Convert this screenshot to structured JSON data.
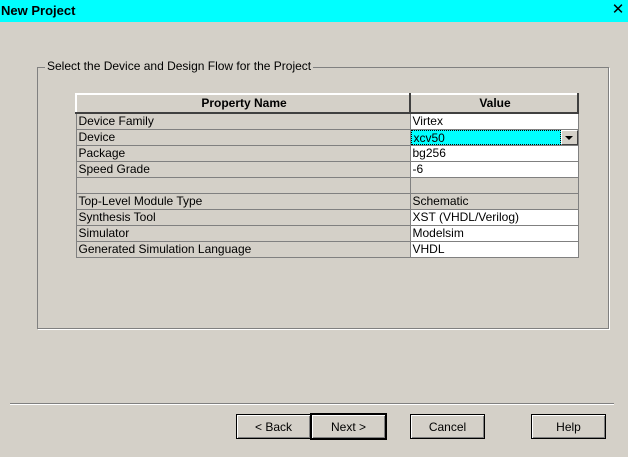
{
  "window": {
    "title": "New Project",
    "close_glyph": "✕"
  },
  "group": {
    "legend": "Select the Device and Design Flow for the Project"
  },
  "table": {
    "headers": {
      "name": "Property Name",
      "value": "Value"
    },
    "rows": [
      {
        "name": "Device Family",
        "value": "Virtex"
      },
      {
        "name": "Device",
        "value": "xcv50"
      },
      {
        "name": "Package",
        "value": "bg256"
      },
      {
        "name": "Speed Grade",
        "value": "-6"
      },
      {
        "name": "",
        "value": ""
      },
      {
        "name": "Top-Level Module Type",
        "value": "Schematic"
      },
      {
        "name": "Synthesis Tool",
        "value": "XST (VHDL/Verilog)"
      },
      {
        "name": "Simulator",
        "value": "Modelsim"
      },
      {
        "name": "Generated Simulation Language",
        "value": "VHDL"
      }
    ]
  },
  "buttons": {
    "back": "< Back",
    "next": "Next >",
    "cancel": "Cancel",
    "help": "Help"
  },
  "colors": {
    "title_bar": "#00ffff",
    "selection": "#00ffff",
    "face": "#d4d0c8"
  }
}
